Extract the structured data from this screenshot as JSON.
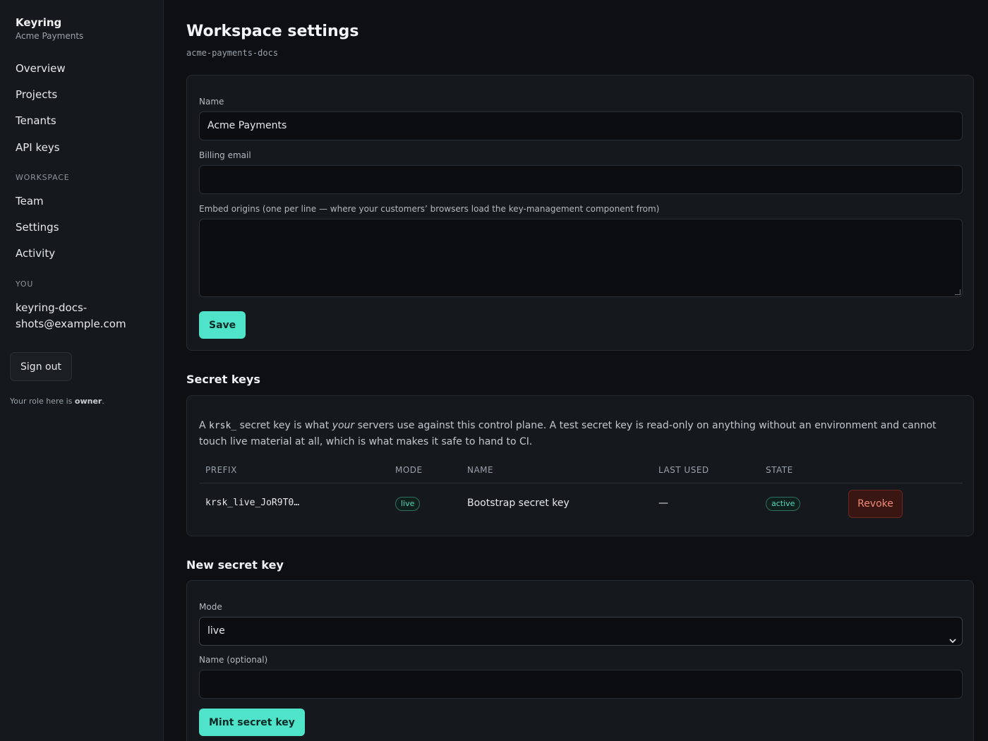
{
  "sidebar": {
    "brand": "Keyring",
    "org": "Acme Payments",
    "items": [
      "Overview",
      "Projects",
      "Tenants",
      "API keys"
    ],
    "workspace_heading": "WORKSPACE",
    "workspace_items": [
      "Team",
      "Settings",
      "Activity"
    ],
    "you_heading": "YOU",
    "email": "keyring-docs-shots@example.com",
    "sign_out": "Sign out",
    "role_prefix": "Your role here is",
    "role": "owner",
    "role_suffix": "."
  },
  "header": {
    "title": "Workspace settings",
    "slug": "acme-payments-docs"
  },
  "settings_form": {
    "name_label": "Name",
    "name_value": "Acme Payments",
    "billing_label": "Billing email",
    "billing_value": "",
    "origins_label": "Embed origins (one per line — where your customers’ browsers load the key-management component from)",
    "origins_value": "",
    "save_label": "Save"
  },
  "secret_keys": {
    "title": "Secret keys",
    "intro_a": "A ",
    "intro_code": "krsk_",
    "intro_b": " secret key is what ",
    "intro_em": "your",
    "intro_c": " servers use against this control plane. A test secret key is read-only on anything without an environment and cannot touch live material at all, which is what makes it safe to hand to CI.",
    "columns": [
      "PREFIX",
      "MODE",
      "NAME",
      "LAST USED",
      "STATE"
    ],
    "rows": [
      {
        "prefix": "krsk_live_JoR9T0…",
        "mode": "live",
        "name": "Bootstrap secret key",
        "last_used": "—",
        "state": "active",
        "action": "Revoke"
      }
    ]
  },
  "new_key": {
    "title": "New secret key",
    "mode_label": "Mode",
    "mode_value": "live",
    "name_label": "Name (optional)",
    "name_value": "",
    "submit_label": "Mint secret key"
  },
  "colors": {
    "accent": "#4fe3c9",
    "danger": "#f08a78",
    "background": "#0d0f12",
    "panel": "#15181c"
  }
}
